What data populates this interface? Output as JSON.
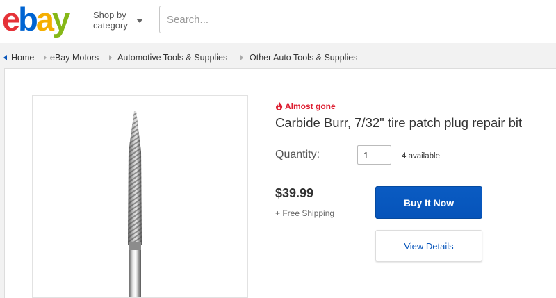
{
  "header": {
    "logo_letters": [
      "e",
      "b",
      "a",
      "y"
    ],
    "shop_by_line1": "Shop by",
    "shop_by_line2": "category",
    "search_placeholder": "Search..."
  },
  "breadcrumb": {
    "items": [
      "Home",
      "eBay Motors",
      "Automotive Tools & Supplies",
      "Other Auto Tools & Supplies"
    ]
  },
  "listing": {
    "alert": "Almost gone",
    "title": "Carbide Burr, 7/32\" tire patch plug repair bit",
    "quantity_label": "Quantity:",
    "quantity_value": "1",
    "available": "4 available",
    "price": "$39.99",
    "shipping": "+ Free Shipping",
    "buy_button": "Buy It Now",
    "details_button": "View Details",
    "image_alt_icon": "carbide-burr-bit"
  },
  "colors": {
    "logo_e": "#e53238",
    "logo_b": "#0064d2",
    "logo_a": "#f5af02",
    "logo_y": "#86b817",
    "buy_button": "#0654ba",
    "alert": "#dd1e31",
    "link": "#0654ba"
  }
}
